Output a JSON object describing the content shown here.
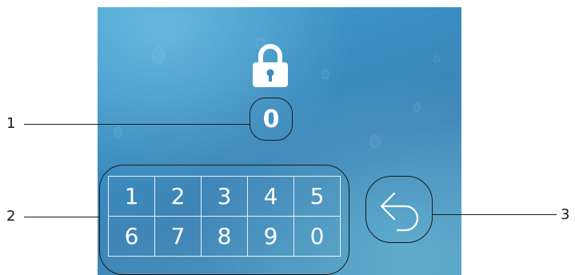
{
  "callouts": {
    "one": "1",
    "two": "2",
    "three": "3"
  },
  "screen": {
    "lock_icon": "lock-icon",
    "code_value": "0",
    "keypad_keys": [
      "1",
      "2",
      "3",
      "4",
      "5",
      "6",
      "7",
      "8",
      "9",
      "0"
    ],
    "back_icon": "back-arrow-icon",
    "colors": {
      "background": "#3a8cc0",
      "foreground": "#ffffff",
      "outline": "#1a1a1a"
    }
  }
}
